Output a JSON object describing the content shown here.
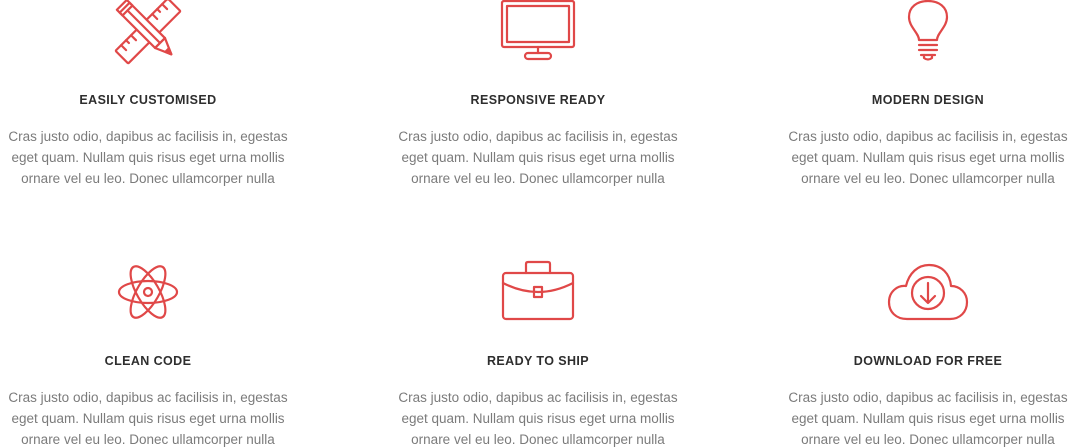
{
  "colors": {
    "accent": "#e04848",
    "title": "#2e2e2e",
    "text": "#7b7b7b"
  },
  "features": [
    {
      "icon": "pencil-ruler-icon",
      "title": "EASILY CUSTOMISED",
      "lines": [
        "Cras justo odio, dapibus ac facilisis in, egestas",
        "eget quam. Nullam quis risus eget urna mollis",
        "ornare vel eu leo. Donec ullamcorper nulla"
      ]
    },
    {
      "icon": "monitor-icon",
      "title": "RESPONSIVE READY",
      "lines": [
        "Cras justo odio, dapibus ac facilisis in, egestas",
        "eget quam. Nullam quis risus eget urna mollis",
        "ornare vel eu leo. Donec ullamcorper nulla"
      ]
    },
    {
      "icon": "lightbulb-icon",
      "title": "MODERN DESIGN",
      "lines": [
        "Cras justo odio, dapibus ac facilisis in, egestas",
        "eget quam. Nullam quis risus eget urna mollis",
        "ornare vel eu leo. Donec ullamcorper nulla"
      ]
    },
    {
      "icon": "atom-icon",
      "title": "CLEAN CODE",
      "lines": [
        "Cras justo odio, dapibus ac facilisis in, egestas",
        "eget quam. Nullam quis risus eget urna mollis",
        "ornare vel eu leo. Donec ullamcorper nulla"
      ]
    },
    {
      "icon": "briefcase-icon",
      "title": "READY TO SHIP",
      "lines": [
        "Cras justo odio, dapibus ac facilisis in, egestas",
        "eget quam. Nullam quis risus eget urna mollis",
        "ornare vel eu leo. Donec ullamcorper nulla"
      ]
    },
    {
      "icon": "cloud-download-icon",
      "title": "DOWNLOAD FOR FREE",
      "lines": [
        "Cras justo odio, dapibus ac facilisis in, egestas",
        "eget quam. Nullam quis risus eget urna mollis",
        "ornare vel eu leo. Donec ullamcorper nulla"
      ]
    }
  ]
}
